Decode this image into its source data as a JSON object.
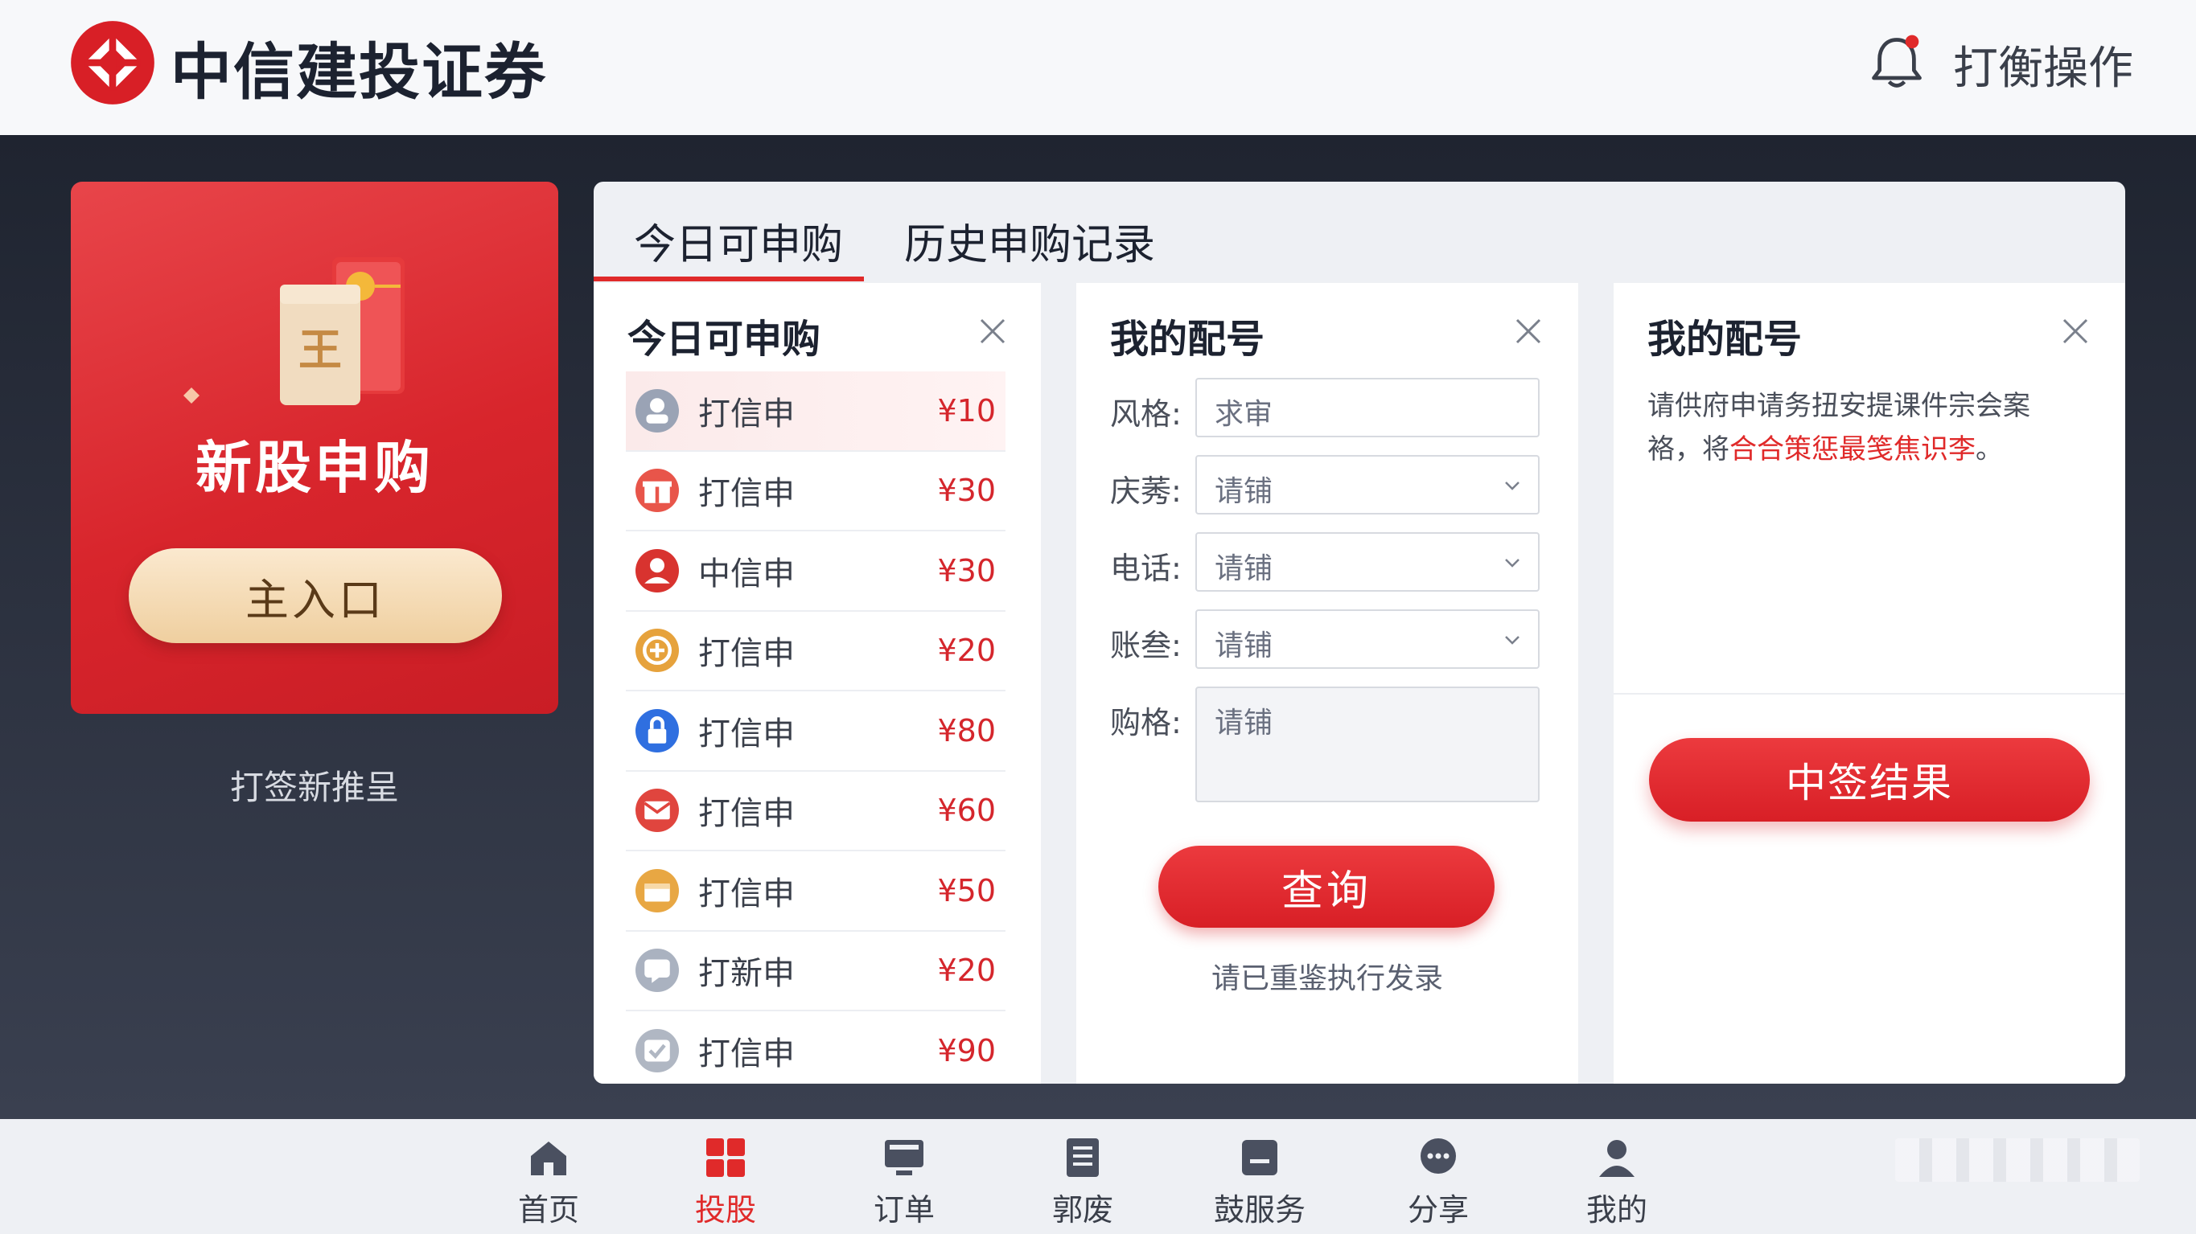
{
  "header": {
    "brand": "中信建投证券",
    "action": "打衡操作"
  },
  "promo": {
    "title": "新股申购",
    "button": "主入口",
    "caption": "打签新推呈"
  },
  "tabs": [
    {
      "label": "今日可申购",
      "active": true
    },
    {
      "label": "历史申购记录",
      "active": false
    }
  ],
  "list_panel": {
    "title": "今日可申购",
    "items": [
      {
        "label": "打信申",
        "price": "¥10",
        "icon": "user-icon",
        "color": "#9aa3b5"
      },
      {
        "label": "打信申",
        "price": "¥30",
        "icon": "gift-icon",
        "color": "#e8554a"
      },
      {
        "label": "中信申",
        "price": "¥30",
        "icon": "person-icon",
        "color": "#d8332f"
      },
      {
        "label": "打信申",
        "price": "¥20",
        "icon": "plus-icon",
        "color": "#e6a23c"
      },
      {
        "label": "打信申",
        "price": "¥80",
        "icon": "lock-icon",
        "color": "#2f6fe0"
      },
      {
        "label": "打信申",
        "price": "¥60",
        "icon": "mail-icon",
        "color": "#e0453e"
      },
      {
        "label": "打信申",
        "price": "¥50",
        "icon": "box-icon",
        "color": "#e8a743"
      },
      {
        "label": "打新申",
        "price": "¥20",
        "icon": "chat-icon",
        "color": "#aab2c0"
      },
      {
        "label": "打信申",
        "price": "¥90",
        "icon": "check-icon",
        "color": "#b0b7c3"
      }
    ]
  },
  "form_panel": {
    "title": "我的配号",
    "fields": [
      {
        "label": "风格:",
        "value": "求审",
        "type": "text"
      },
      {
        "label": "庆莠:",
        "value": "请铺",
        "type": "select"
      },
      {
        "label": "电话:",
        "value": "请铺",
        "type": "select"
      },
      {
        "label": "账叁:",
        "value": "请铺",
        "type": "select"
      },
      {
        "label": "购格:",
        "value": "请铺",
        "type": "textarea"
      }
    ],
    "query_button": "查询",
    "hint": "请已重鉴执行发录"
  },
  "info_panel": {
    "title": "我的配号",
    "text_plain": "请供府申请务扭安提课件宗会案袼，将",
    "text_red": "合合策惩最笺焦识李",
    "text_end": "。",
    "result_button": "中签结果"
  },
  "bottom_nav": [
    {
      "label": "首页",
      "icon": "home-icon",
      "active": false
    },
    {
      "label": "投股",
      "icon": "grid-icon",
      "active": true
    },
    {
      "label": "订单",
      "icon": "monitor-icon",
      "active": false
    },
    {
      "label": "郭废",
      "icon": "document-icon",
      "active": false
    },
    {
      "label": "鼓服务",
      "icon": "service-icon",
      "active": false
    },
    {
      "label": "分享",
      "icon": "chat-bubble-icon",
      "active": false
    },
    {
      "label": "我的",
      "icon": "user-profile-icon",
      "active": false
    }
  ],
  "colors": {
    "brand_red": "#d81f26",
    "accent_red": "#e02a2a",
    "gold": "#efcf9f"
  }
}
